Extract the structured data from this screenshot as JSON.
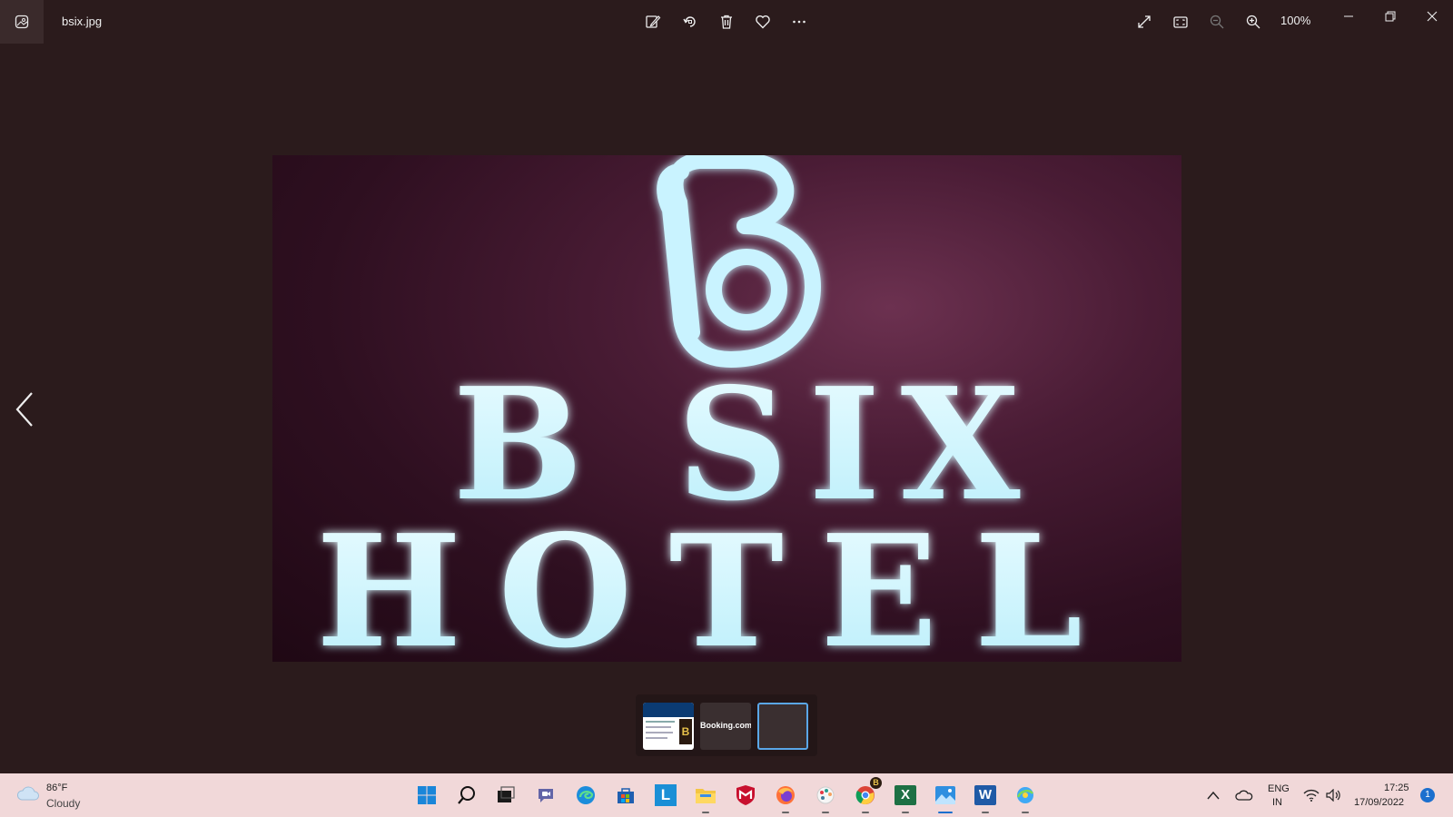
{
  "window": {
    "file_name": "bsix.jpg",
    "zoom": "100%"
  },
  "toolbar": {
    "actions": [
      "edit-image-icon",
      "rotate-icon",
      "delete-icon",
      "favorite-icon",
      "more-icon"
    ],
    "right": [
      "fullscreen-icon",
      "fit-icon",
      "zoom-out-icon",
      "zoom-in-icon"
    ]
  },
  "photo": {
    "logo_letter": "B",
    "line1": "B SIX",
    "line2": "HOTEL"
  },
  "filmstrip": {
    "thumbs": [
      {
        "kind": "document",
        "logo_letter": "B"
      },
      {
        "kind": "text",
        "text": "Booking.com"
      },
      {
        "kind": "selected"
      }
    ]
  },
  "taskbar": {
    "weather": {
      "temp": "86°F",
      "condition": "Cloudy"
    },
    "apps": [
      "windows-start-icon",
      "search-icon",
      "task-view-icon",
      "teams-chat-icon",
      "edge-icon",
      "store-icon",
      "l-app-icon",
      "file-explorer-icon",
      "mcafee-icon",
      "firefox-icon",
      "paint-icon",
      "chrome-icon",
      "excel-icon",
      "photos-icon",
      "word-icon",
      "internet-explorer-icon"
    ],
    "l_app_letter": "L",
    "excel_letter": "X",
    "word_letter": "W",
    "chrome_badge": "B",
    "language": {
      "line1": "ENG",
      "line2": "IN"
    },
    "clock": {
      "time": "17:25",
      "date": "17/09/2022"
    },
    "notification_count": "1"
  },
  "colors": {
    "background": "#2b1b1c",
    "taskbar": "#f1d8d9",
    "sign_glow": "#d8f6ff",
    "accent": "#1b6fce"
  }
}
